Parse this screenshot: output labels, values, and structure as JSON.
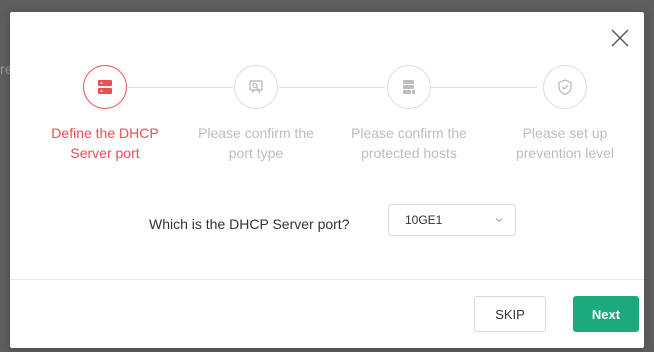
{
  "background": {
    "fragment_text": "re"
  },
  "modal": {
    "close_icon": "close-icon",
    "steps": [
      {
        "label": "Define the DHCP\nServer port",
        "icon": "server-icon",
        "active": true
      },
      {
        "label": "Please confirm the\nport type",
        "icon": "port-type-icon",
        "active": false
      },
      {
        "label": "Please confirm the\nprotected hosts",
        "icon": "hosts-icon",
        "active": false
      },
      {
        "label": "Please set up\nprevention level",
        "icon": "shield-check-icon",
        "active": false
      }
    ],
    "question": {
      "label": "Which is the DHCP Server port?",
      "selected_value": "10GE1"
    },
    "footer": {
      "skip_label": "SKIP",
      "next_label": "Next"
    }
  },
  "colors": {
    "active": "#f04a55",
    "inactive": "#bdbdbd",
    "primary_button": "#1aaa7c"
  }
}
